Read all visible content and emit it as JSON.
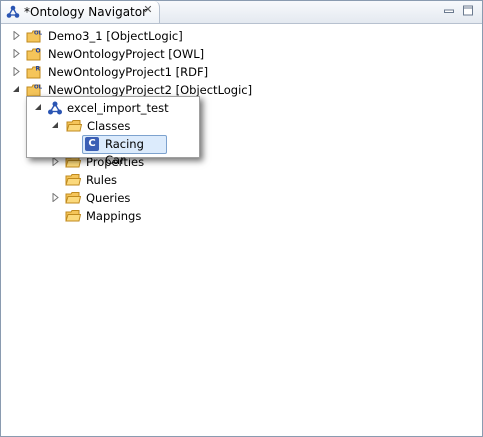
{
  "view": {
    "title": "*Ontology Navigator",
    "icons": {
      "tab": "ontology-navigator-icon",
      "close": "close-icon",
      "minimize": "minimize-icon",
      "maximize": "maximize-icon"
    }
  },
  "tree": {
    "projects": [
      {
        "label": "Demo3_1 [ObjectLogic]",
        "badge": "OL",
        "expanded": false
      },
      {
        "label": "NewOntologyProject [OWL]",
        "badge": "O",
        "expanded": false
      },
      {
        "label": "NewOntologyProject1 [RDF]",
        "badge": "R",
        "expanded": false
      },
      {
        "label": "NewOntologyProject2 [ObjectLogic]",
        "badge": "OL",
        "expanded": true
      }
    ],
    "folders": [
      {
        "label": "Properties",
        "expandable": true
      },
      {
        "label": "Rules",
        "expandable": false
      },
      {
        "label": "Queries",
        "expandable": true
      },
      {
        "label": "Mappings",
        "expandable": false
      }
    ]
  },
  "popup": {
    "ontology": "excel_import_test",
    "folder": "Classes",
    "class_badge": "C",
    "class_item": "Racing Car"
  },
  "colors": {
    "folder": "#f5c55a",
    "selection": "#dcebfc",
    "class_badge": "#3b5fb5"
  }
}
